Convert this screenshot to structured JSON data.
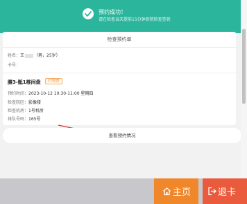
{
  "banner": {
    "title": "预约成功！",
    "subtitle": "请在检查当天提前15分钟到院检查签到"
  },
  "card": {
    "title": "检查预约单",
    "patient": {
      "name_label": "姓名：",
      "name_prefix": "王",
      "name_suffix": "（男，25岁）",
      "card_label": "卡号："
    },
    "exam": {
      "name": "腰3-骶1椎间盘",
      "tag": "CT检查",
      "rows": [
        {
          "label": "预约时间：",
          "value": "2023-10-12 10:30-11:00 星期四"
        },
        {
          "label": "检查院区：",
          "value": "影像楼"
        },
        {
          "label": "检查机房：",
          "value": "1号机房"
        },
        {
          "label": "排队号码：",
          "value": "165号"
        }
      ]
    }
  },
  "view_button": {
    "label": "查看预约情况"
  },
  "footer": {
    "home_label": "主页",
    "checkout_label": "退卡"
  },
  "colors": {
    "accent": "#2bb59c",
    "home": "#f0872a",
    "checkout": "#ea5a3c",
    "tag": "#f08a22",
    "arrow": "#d9342b"
  },
  "icons": [
    "check-circle-icon",
    "home-icon",
    "logout-icon",
    "arrow-icon"
  ]
}
